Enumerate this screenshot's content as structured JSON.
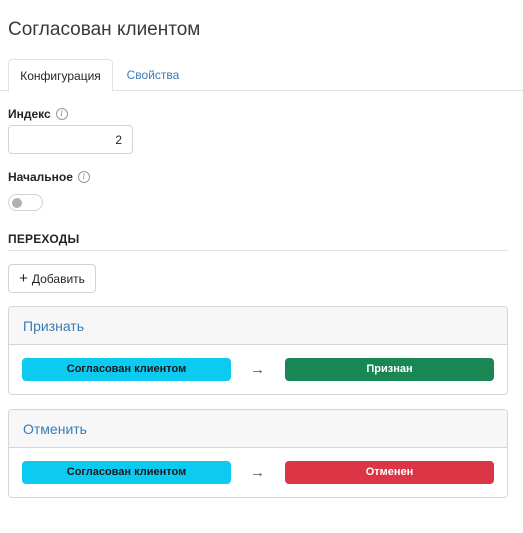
{
  "page": {
    "title": "Согласован клиентом"
  },
  "tabs": [
    {
      "label": "Конфигурация",
      "active": true
    },
    {
      "label": "Свойства",
      "active": false
    }
  ],
  "fields": {
    "index": {
      "label": "Индекс",
      "value": "2"
    },
    "initial": {
      "label": "Начальное",
      "checked": false
    }
  },
  "transitions": {
    "title": "ПЕРЕХОДЫ",
    "add_label": "Добавить",
    "items": [
      {
        "name": "Признать",
        "from": "Согласован клиентом",
        "to": "Признан",
        "to_color": "#198754"
      },
      {
        "name": "Отменить",
        "from": "Согласован клиентом",
        "to": "Отменен",
        "to_color": "#dc3545"
      }
    ]
  },
  "colors": {
    "from_status": "#0dcaf0",
    "link": "#3a7bb5"
  },
  "icons": {
    "info": "info-circle-icon",
    "add": "plus-icon",
    "arrow": "arrow-right-icon"
  }
}
